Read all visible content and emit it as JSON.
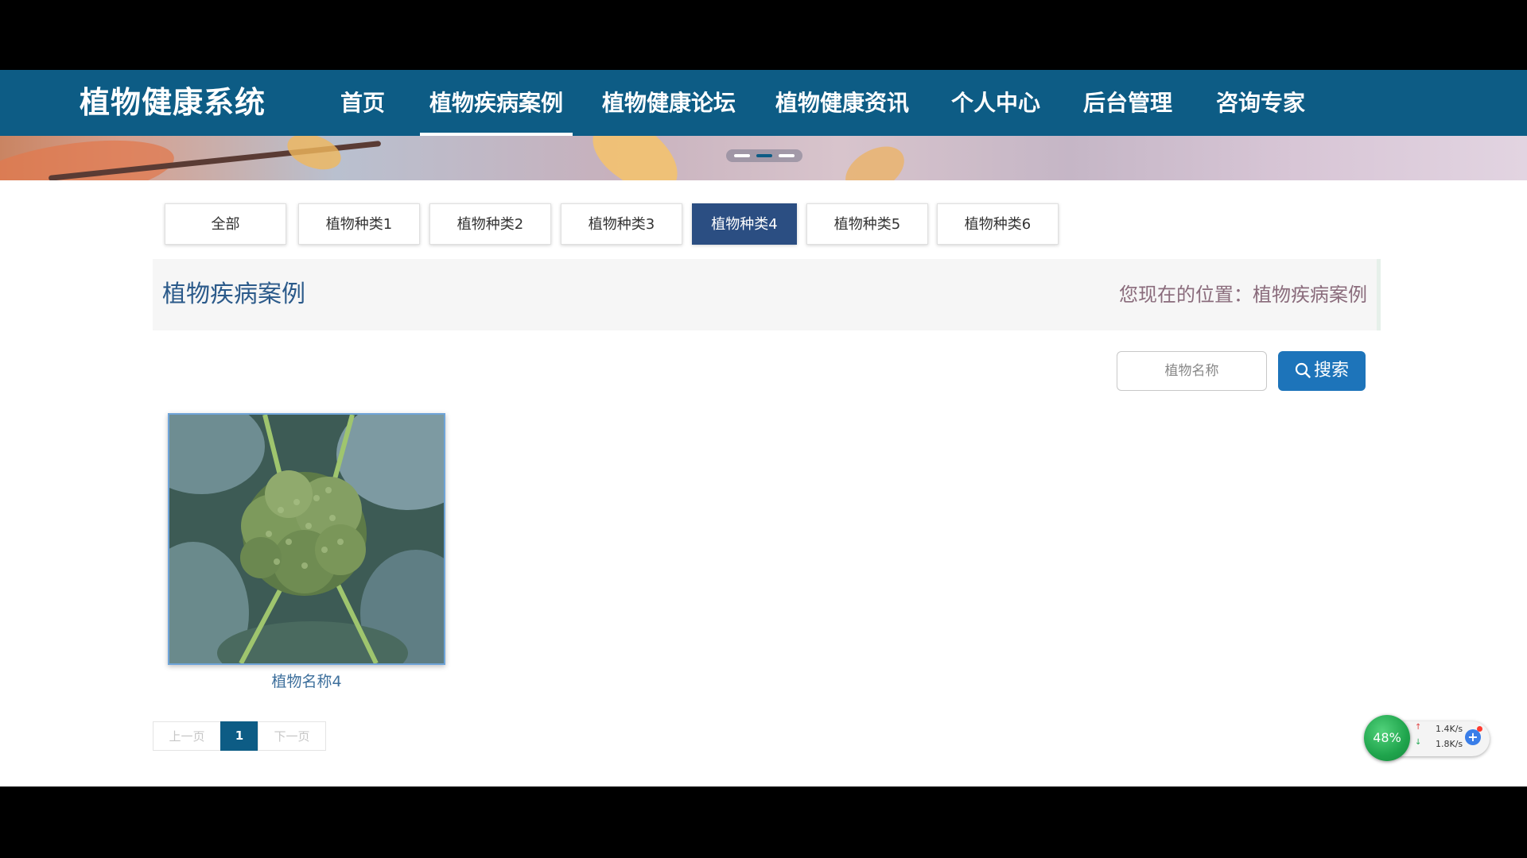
{
  "nav": {
    "brand": "植物健康系统",
    "items": [
      "首页",
      "植物疾病案例",
      "植物健康论坛",
      "植物健康资讯",
      "个人中心",
      "后台管理",
      "咨询专家"
    ],
    "active_index": 1
  },
  "categories": {
    "items": [
      "全部",
      "植物种类1",
      "植物种类2",
      "植物种类3",
      "植物种类4",
      "植物种类5",
      "植物种类6"
    ],
    "active_index": 4
  },
  "section": {
    "title": "植物疾病案例",
    "breadcrumb": "您现在的位置：植物疾病案例"
  },
  "search": {
    "placeholder": "植物名称",
    "button_label": "搜索",
    "icon": "search-icon"
  },
  "results": [
    {
      "name": "植物名称4",
      "image": "broccoli-photo"
    }
  ],
  "pagination": {
    "prev": "上一页",
    "current": "1",
    "next": "下一页"
  },
  "widget": {
    "percent": "48%",
    "upload": "1.4K/s",
    "download": "1.8K/s"
  },
  "colors": {
    "nav_bg": "#0d5c85",
    "active_tab": "#2b4e82",
    "search_button": "#1d74ba",
    "title_text": "#2b5a8a"
  }
}
